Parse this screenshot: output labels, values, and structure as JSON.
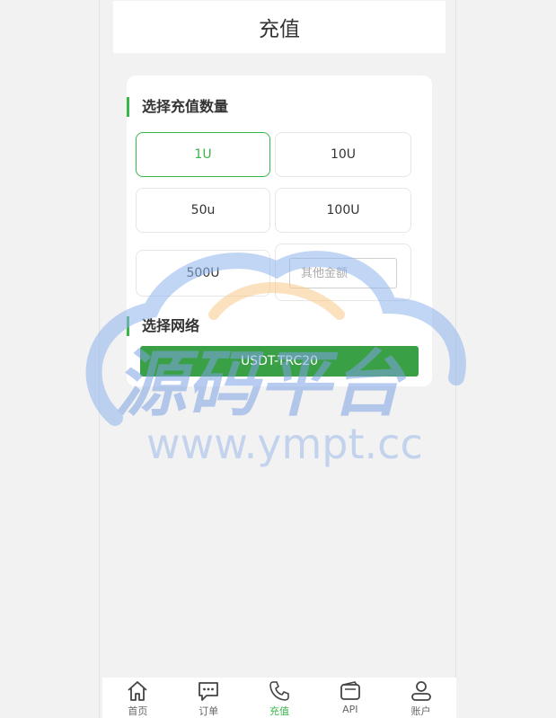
{
  "header": {
    "title": "充值"
  },
  "amount_section": {
    "title": "选择充值数量"
  },
  "amounts": [
    {
      "label": "1U",
      "selected": true
    },
    {
      "label": "10U",
      "selected": false
    },
    {
      "label": "50u",
      "selected": false
    },
    {
      "label": "100U",
      "selected": false
    },
    {
      "label": "500U",
      "selected": false
    }
  ],
  "custom_amount": {
    "placeholder": "其他金额",
    "value": ""
  },
  "network_section": {
    "title": "选择网络"
  },
  "network": {
    "label": "USDT-TRC20"
  },
  "watermark": {
    "brand": "源码平台",
    "url": "www.ympt.cc"
  },
  "tabs": [
    {
      "label": "首页",
      "icon": "home-icon",
      "active": false
    },
    {
      "label": "订单",
      "icon": "chat-bubble-icon",
      "active": false
    },
    {
      "label": "充值",
      "icon": "phone-icon",
      "active": true
    },
    {
      "label": "API",
      "icon": "wallet-icon",
      "active": false
    },
    {
      "label": "账户",
      "icon": "user-icon",
      "active": false
    }
  ],
  "colors": {
    "accent": "#3ab54a",
    "button": "#3aa046",
    "background": "#f2f2f2"
  }
}
